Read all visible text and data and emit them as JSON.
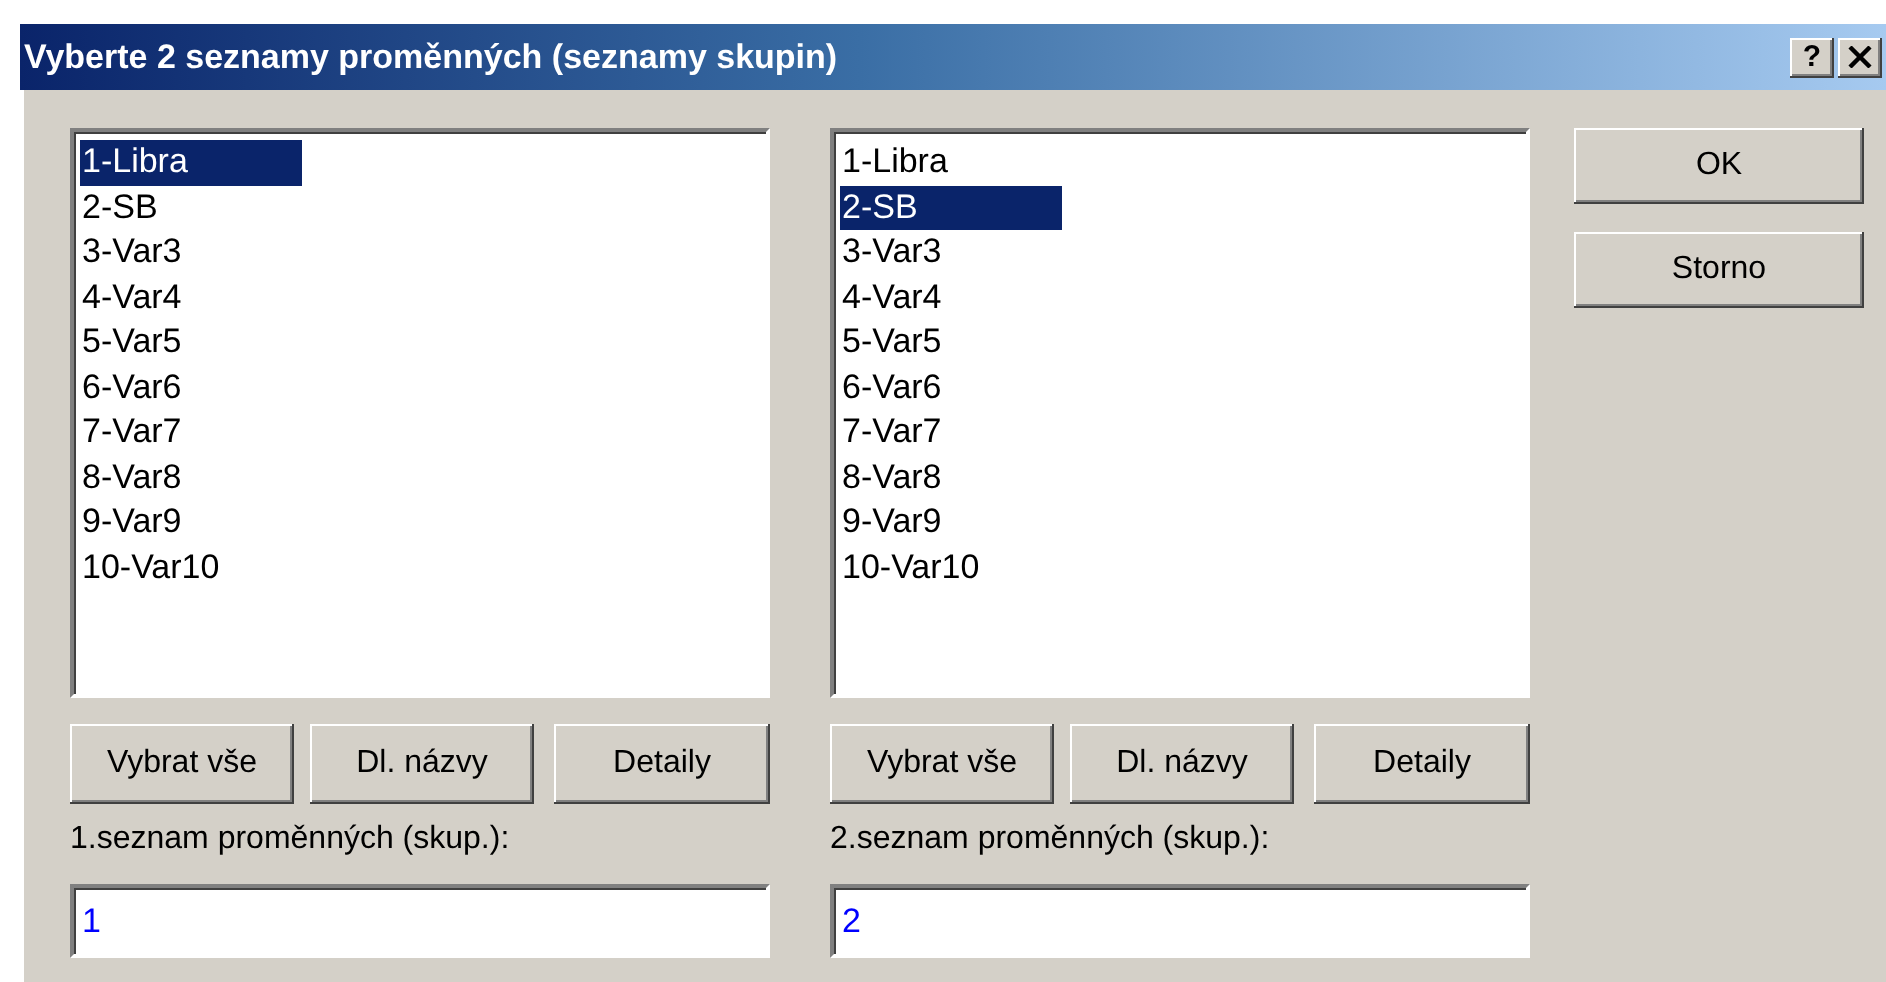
{
  "window": {
    "title": "Vyberte 2 seznamy proměnných (seznamy skupin)",
    "help_button": "?"
  },
  "panels": [
    {
      "items": [
        {
          "label": "1-Libra",
          "selected": true
        },
        {
          "label": "2-SB",
          "selected": false
        },
        {
          "label": "3-Var3",
          "selected": false
        },
        {
          "label": "4-Var4",
          "selected": false
        },
        {
          "label": "5-Var5",
          "selected": false
        },
        {
          "label": "6-Var6",
          "selected": false
        },
        {
          "label": "7-Var7",
          "selected": false
        },
        {
          "label": "8-Var8",
          "selected": false
        },
        {
          "label": "9-Var9",
          "selected": false
        },
        {
          "label": "10-Var10",
          "selected": false
        }
      ],
      "buttons": [
        "Vybrat vše",
        "Dl. názvy",
        "Detaily"
      ],
      "field_label": "1.seznam proměnných (skup.):",
      "field_value": "1"
    },
    {
      "items": [
        {
          "label": "1-Libra",
          "selected": false
        },
        {
          "label": "2-SB",
          "selected": true
        },
        {
          "label": "3-Var3",
          "selected": false
        },
        {
          "label": "4-Var4",
          "selected": false
        },
        {
          "label": "5-Var5",
          "selected": false
        },
        {
          "label": "6-Var6",
          "selected": false
        },
        {
          "label": "7-Var7",
          "selected": false
        },
        {
          "label": "8-Var8",
          "selected": false
        },
        {
          "label": "9-Var9",
          "selected": false
        },
        {
          "label": "10-Var10",
          "selected": false
        }
      ],
      "buttons": [
        "Vybrat vše",
        "Dl. názvy",
        "Detaily"
      ],
      "field_label": "2.seznam proměnných (skup.):",
      "field_value": "2"
    }
  ],
  "dialog_buttons": [
    "OK",
    "Storno"
  ]
}
